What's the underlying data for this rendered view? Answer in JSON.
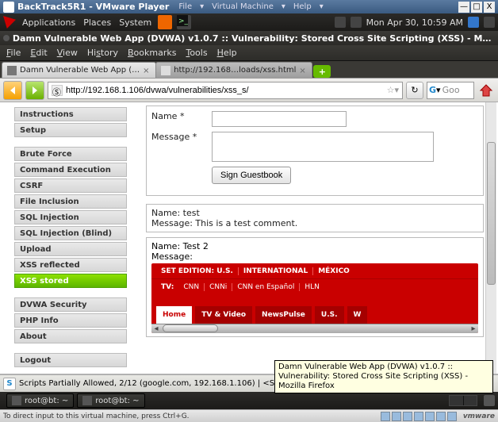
{
  "vmware": {
    "title": "BackTrack5R1 - VMware Player",
    "menu": [
      "File",
      "Virtual Machine",
      "Help"
    ],
    "hint": "To direct input to this virtual machine, press Ctrl+G.",
    "logo": "vmware"
  },
  "gnome_top": {
    "menus": [
      "Applications",
      "Places",
      "System"
    ],
    "clock": "Mon Apr 30, 10:59 AM"
  },
  "firefox": {
    "window_title": "Damn Vulnerable Web App (DVWA) v1.0.7 :: Vulnerability: Stored Cross Site Scripting (XSS) - Mozil",
    "menubar": [
      "File",
      "Edit",
      "View",
      "History",
      "Bookmarks",
      "Tools",
      "Help"
    ],
    "tabs": [
      {
        "label": "Damn Vulnerable Web App (…",
        "active": true
      },
      {
        "label": "http://192.168…loads/xss.html",
        "active": false
      }
    ],
    "url": "http://192.168.1.106/dvwa/vulnerabilities/xss_s/",
    "search_placeholder": "Goo",
    "status": "Scripts Partially Allowed, 2/12 (google.com, 192.168.1.106) | <SCR",
    "tooltip": "Damn Vulnerable Web App (DVWA) v1.0.7 :: Vulnerability: Stored Cross Site Scripting (XSS) - Mozilla Firefox"
  },
  "sidebar": {
    "groups": [
      [
        "Instructions",
        "Setup"
      ],
      [
        "Brute Force",
        "Command Execution",
        "CSRF",
        "File Inclusion",
        "SQL Injection",
        "SQL Injection (Blind)",
        "Upload",
        "XSS reflected",
        "XSS stored"
      ],
      [
        "DVWA Security",
        "PHP Info",
        "About"
      ],
      [
        "Logout"
      ]
    ],
    "active": "XSS stored"
  },
  "form": {
    "name_label": "Name *",
    "message_label": "Message *",
    "submit": "Sign Guestbook"
  },
  "entries": [
    {
      "name_line": "Name: test",
      "msg_line": "Message: This is a test comment."
    }
  ],
  "entry2": {
    "name_line": "Name: Test 2",
    "msg_line": "Message:"
  },
  "cnn": {
    "top": [
      "SET EDITION:  U.S.",
      "INTERNATIONAL",
      "MÉXICO"
    ],
    "tv_label": "TV:",
    "tv": [
      "CNN",
      "CNNi",
      "CNN en Español",
      "HLN"
    ],
    "tabs": [
      "Home",
      "TV & Video",
      "NewsPulse",
      "U.S.",
      "W"
    ]
  },
  "taskbar": {
    "items": [
      "root@bt: ~",
      "root@bt: ~"
    ]
  }
}
